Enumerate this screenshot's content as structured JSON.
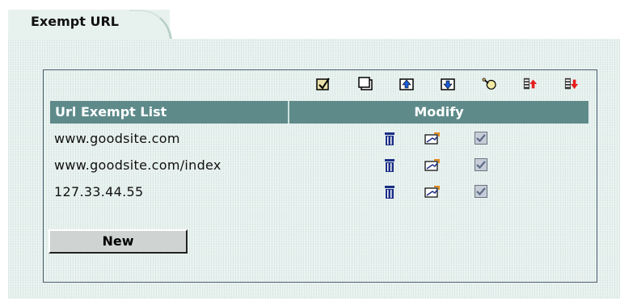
{
  "tab": {
    "title": "Exempt URL"
  },
  "toolbar": {
    "icons": [
      "edit-icon",
      "window-icon",
      "move-up-icon",
      "move-down-icon",
      "clear-icon",
      "import-icon",
      "export-icon"
    ]
  },
  "table": {
    "headers": [
      "Url Exempt List",
      "Modify"
    ],
    "rows": [
      {
        "url": "www.goodsite.com",
        "enabled": true
      },
      {
        "url": "www.goodsite.com/index",
        "enabled": true
      },
      {
        "url": "127.33.44.55",
        "enabled": true
      }
    ]
  },
  "buttons": {
    "new_label": "New"
  },
  "colors": {
    "header_bg": "#5e8a8a",
    "panel_bg": "#e7f2ef",
    "icon_blue": "#1a2e86"
  }
}
